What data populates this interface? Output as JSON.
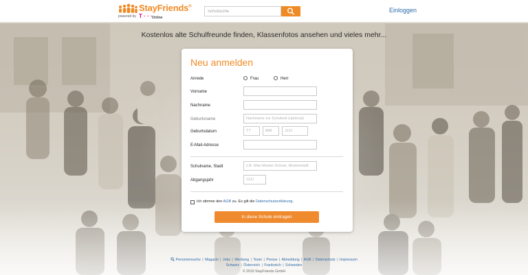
{
  "header": {
    "logo_name": "StayFriends",
    "logo_reg": "®",
    "powered_by": "powered by",
    "telekom_mark": "T · · ·",
    "online": "Online",
    "search_placeholder": "Schulsuche",
    "search_icon": "search-icon",
    "login_label": "Einloggen"
  },
  "tagline": "Kostenlos alte Schulfreunde finden, Klassenfotos ansehen und vieles mehr...",
  "form": {
    "title": "Neu anmelden",
    "salutation_label": "Anrede",
    "salutation_options": [
      "Frau",
      "Herr"
    ],
    "first_name_label": "Vorname",
    "first_name_value": "",
    "last_name_label": "Nachname",
    "last_name_value": "",
    "birth_name_label": "Geburtsname",
    "birth_name_placeholder": "Nachname zur Schulzeit (optional)",
    "birth_date_label": "Geburtsdatum",
    "birth_day_placeholder": "TT",
    "birth_month_placeholder": "MM",
    "birth_year_placeholder": "JJJJ",
    "email_label": "E-Mail-Adresse",
    "email_value": "",
    "school_label": "Schulname, Stadt",
    "school_placeholder": "z.B. Max-Muster-Schule, Musterstadt",
    "graduation_label": "Abgangsjahr",
    "graduation_placeholder": "JJJJ",
    "consent_prefix": "Ich stimme den",
    "consent_agb": "AGB",
    "consent_middle": "zu. Es gilt die",
    "consent_privacy": "Datenschutzerklärung",
    "consent_suffix": ".",
    "submit_label": "In diese Schule eintragen"
  },
  "footer": {
    "search_people": "Personensuche",
    "links_row1": [
      "Magazin",
      "Jobs",
      "Werbung",
      "Team",
      "Presse",
      "Abmeldung",
      "AGB",
      "Datenschutz",
      "Impressum"
    ],
    "links_row2": [
      "Schweiz",
      "Österreich",
      "Frankreich",
      "Schweden"
    ],
    "copyright": "© 2019 StayFriends GmbH"
  },
  "colors": {
    "brand_orange": "#f08a24",
    "link_blue": "#2b6aa8",
    "telekom_magenta": "#e20074"
  }
}
